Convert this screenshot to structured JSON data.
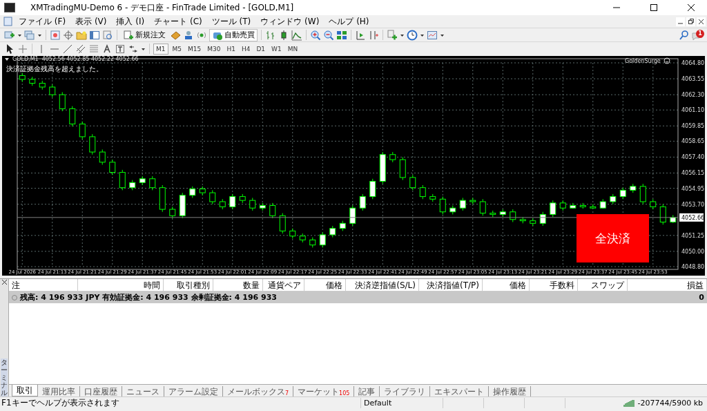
{
  "window": {
    "title": "XMTradingMU-Demo 6 - デモ口座 - FinTrade Limited - [GOLD,M1]"
  },
  "menu": [
    "ファイル (F)",
    "表示 (V)",
    "挿入 (I)",
    "チャート (C)",
    "ツール (T)",
    "ウィンドウ (W)",
    "ヘルプ (H)"
  ],
  "toolbar": {
    "new_order": "新規注文",
    "auto_trading": "自動売買",
    "notification_count": "1"
  },
  "timeframes": [
    {
      "label": "M1",
      "selected": true
    },
    {
      "label": "M5",
      "selected": false
    },
    {
      "label": "M15",
      "selected": false
    },
    {
      "label": "M30",
      "selected": false
    },
    {
      "label": "H1",
      "selected": false
    },
    {
      "label": "H4",
      "selected": false
    },
    {
      "label": "D1",
      "selected": false
    },
    {
      "label": "W1",
      "selected": false
    },
    {
      "label": "MN",
      "selected": false
    }
  ],
  "chart": {
    "symbol": "GOLD,M1",
    "ohlc": "4052.56 4052.85 4052.22 4052.66",
    "message": "決済証拠金残高を超えました。",
    "expert": "GoldenSurge",
    "close_all_button": "全決済",
    "chart_data": {
      "type": "candlestick",
      "grid": true,
      "ylim": [
        4048.8,
        4064.8
      ],
      "categories": [
        "24 Jul 2026",
        null,
        null,
        "24 Jul 21:13",
        null,
        null,
        "24 Jul 21:21",
        null,
        null,
        "24 Jul 21:29",
        null,
        null,
        "24 Jul 21:37",
        null,
        null,
        "24 Jul 21:45",
        null,
        null,
        "24 Jul 21:53",
        null,
        null,
        "24 Jul 22:01",
        null,
        null,
        "24 Jul 22:09",
        null,
        null,
        "24 Jul 22:17",
        null,
        null,
        "24 Jul 22:25",
        null,
        null,
        "24 Jul 22:33",
        null,
        null,
        "24 Jul 22:41",
        null,
        null,
        "24 Jul 22:49",
        null,
        null,
        "24 Jul 22:57",
        null,
        null,
        "24 Jul 23:05",
        null,
        null,
        "24 Jul 23:13",
        null,
        null,
        "24 Jul 23:21",
        null,
        null,
        "24 Jul 23:29",
        null,
        null,
        "24 Jul 23:37",
        null,
        null,
        "24 Jul 23:45",
        null,
        null,
        "24 Jul 23:53",
        null,
        null
      ],
      "ohlc": [
        [
          4063.8,
          4064.0,
          4063.3,
          4063.5
        ],
        [
          4063.5,
          4063.7,
          4063.0,
          4063.2
        ],
        [
          4063.2,
          4063.4,
          4062.7,
          4062.9
        ],
        [
          4062.9,
          4063.1,
          4062.1,
          4062.3
        ],
        [
          4062.3,
          4062.5,
          4061.0,
          4061.2
        ],
        [
          4061.2,
          4061.4,
          4059.8,
          4060.0
        ],
        [
          4060.0,
          4060.2,
          4058.8,
          4059.0
        ],
        [
          4059.0,
          4059.2,
          4057.6,
          4057.8
        ],
        [
          4057.8,
          4058.0,
          4056.8,
          4057.0
        ],
        [
          4057.0,
          4057.2,
          4056.0,
          4056.2
        ],
        [
          4056.2,
          4056.4,
          4054.8,
          4055.0
        ],
        [
          4055.0,
          4055.6,
          4054.8,
          4055.4
        ],
        [
          4055.4,
          4055.9,
          4055.2,
          4055.7
        ],
        [
          4055.7,
          4055.9,
          4054.8,
          4055.0
        ],
        [
          4055.0,
          4055.2,
          4053.1,
          4053.3
        ],
        [
          4053.3,
          4053.5,
          4052.6,
          4052.8
        ],
        [
          4052.8,
          4054.6,
          4052.6,
          4054.4
        ],
        [
          4054.4,
          4055.1,
          4054.2,
          4054.9
        ],
        [
          4054.9,
          4055.1,
          4054.4,
          4054.6
        ],
        [
          4054.6,
          4054.8,
          4053.7,
          4053.9
        ],
        [
          4053.9,
          4054.1,
          4053.3,
          4053.5
        ],
        [
          4053.5,
          4054.5,
          4053.3,
          4054.3
        ],
        [
          4054.3,
          4054.5,
          4053.8,
          4054.0
        ],
        [
          4054.0,
          4054.2,
          4053.2,
          4053.4
        ],
        [
          4053.4,
          4053.8,
          4053.2,
          4053.6
        ],
        [
          4053.6,
          4053.8,
          4052.6,
          4052.8
        ],
        [
          4052.8,
          4053.0,
          4051.4,
          4051.6
        ],
        [
          4051.6,
          4051.8,
          4051.0,
          4051.2
        ],
        [
          4051.2,
          4051.4,
          4050.7,
          4050.9
        ],
        [
          4050.9,
          4051.1,
          4050.3,
          4050.5
        ],
        [
          4050.5,
          4051.5,
          4050.3,
          4051.3
        ],
        [
          4051.3,
          4052.0,
          4051.1,
          4051.8
        ],
        [
          4051.8,
          4052.4,
          4051.6,
          4052.2
        ],
        [
          4052.2,
          4053.6,
          4052.0,
          4053.4
        ],
        [
          4053.4,
          4054.5,
          4053.2,
          4054.3
        ],
        [
          4054.3,
          4055.7,
          4054.1,
          4055.5
        ],
        [
          4055.5,
          4057.8,
          4055.3,
          4057.6
        ],
        [
          4057.6,
          4057.8,
          4057.0,
          4057.2
        ],
        [
          4057.2,
          4057.4,
          4055.6,
          4055.8
        ],
        [
          4055.8,
          4056.0,
          4054.8,
          4055.0
        ],
        [
          4055.0,
          4055.2,
          4054.1,
          4054.3
        ],
        [
          4054.3,
          4054.5,
          4053.9,
          4054.1
        ],
        [
          4054.1,
          4054.3,
          4052.9,
          4053.1
        ],
        [
          4053.1,
          4053.6,
          4052.9,
          4053.4
        ],
        [
          4053.4,
          4054.2,
          4053.2,
          4054.0
        ],
        [
          4054.0,
          4054.2,
          4053.7,
          4053.9
        ],
        [
          4053.9,
          4054.1,
          4052.8,
          4053.0
        ],
        [
          4053.0,
          4053.2,
          4052.7,
          4052.9
        ],
        [
          4052.9,
          4053.3,
          4052.7,
          4053.1
        ],
        [
          4053.1,
          4053.3,
          4052.3,
          4052.5
        ],
        [
          4052.5,
          4052.7,
          4052.2,
          4052.4
        ],
        [
          4052.4,
          4052.6,
          4052.0,
          4052.2
        ],
        [
          4052.2,
          4053.1,
          4052.0,
          4052.9
        ],
        [
          4052.9,
          4054.0,
          4052.7,
          4053.8
        ],
        [
          4053.8,
          4054.0,
          4053.2,
          4053.4
        ],
        [
          4053.4,
          4053.8,
          4053.35,
          4053.6
        ],
        [
          4053.6,
          4053.8,
          4053.35,
          4053.5
        ],
        [
          4053.5,
          4053.7,
          4053.35,
          4053.4
        ],
        [
          4053.4,
          4054.1,
          4053.35,
          4053.9
        ],
        [
          4053.9,
          4054.5,
          4053.7,
          4054.3
        ],
        [
          4054.3,
          4055.0,
          4054.1,
          4054.8
        ],
        [
          4054.8,
          4055.3,
          4054.6,
          4055.1
        ],
        [
          4055.1,
          4055.3,
          4053.7,
          4053.9
        ],
        [
          4053.9,
          4054.1,
          4053.3,
          4053.5
        ],
        [
          4053.5,
          4053.7,
          4052.1,
          4052.3
        ],
        [
          4052.3,
          4052.85,
          4052.22,
          4052.66
        ]
      ],
      "ref_lines": [
        {
          "axis": "y",
          "value": 4052.66,
          "label": "4052.66",
          "color": "#808080"
        }
      ],
      "yticks": [
        {
          "value": 4064.8,
          "label": "4064.80"
        },
        {
          "value": 4063.55,
          "label": "4063.55"
        },
        {
          "value": 4062.3,
          "label": "4062.30"
        },
        {
          "value": 4061.1,
          "label": "4061.10"
        },
        {
          "value": 4059.85,
          "label": "4059.85"
        },
        {
          "value": 4058.65,
          "label": "4058.65"
        },
        {
          "value": 4057.4,
          "label": "4057.40"
        },
        {
          "value": 4056.15,
          "label": "4056.15"
        },
        {
          "value": 4054.95,
          "label": "4054.95"
        },
        {
          "value": 4053.7,
          "label": "4053.70"
        },
        {
          "value": 4051.25,
          "label": "4051.25"
        },
        {
          "value": 4050,
          "label": "4050.00"
        },
        {
          "value": 4048.8,
          "label": "4048.80"
        }
      ]
    }
  },
  "terminal": {
    "side_label": "ターミナル",
    "columns": [
      "注",
      "時間",
      "取引種別",
      "数量",
      "通貨ペア",
      "価格",
      "決済逆指値(S/L)",
      "決済指値(T/P)",
      "価格",
      "手数料",
      "スワップ",
      "損益"
    ],
    "summary": {
      "text": "残高: 4 196 933 JPY  有効証拠金: 4 196 933  余剰証拠金: 4 196 933",
      "profit": "0"
    },
    "tabs": [
      {
        "label": "取引",
        "selected": true
      },
      {
        "label": "運用比率",
        "selected": false
      },
      {
        "label": "口座履歴",
        "selected": false
      },
      {
        "label": "ニュース",
        "selected": false
      },
      {
        "label": "アラーム設定",
        "selected": false
      },
      {
        "label": "メールボックス",
        "badge": "7",
        "selected": false
      },
      {
        "label": "マーケット",
        "badge": "105",
        "selected": false
      },
      {
        "label": "記事",
        "selected": false
      },
      {
        "label": "ライブラリ",
        "selected": false
      },
      {
        "label": "エキスパート",
        "selected": false
      },
      {
        "label": "操作履歴",
        "selected": false
      }
    ]
  },
  "status_bar": {
    "help": "F1キーでヘルプが表示されます",
    "profile": "Default",
    "traffic": "-207744/5900 kb"
  }
}
